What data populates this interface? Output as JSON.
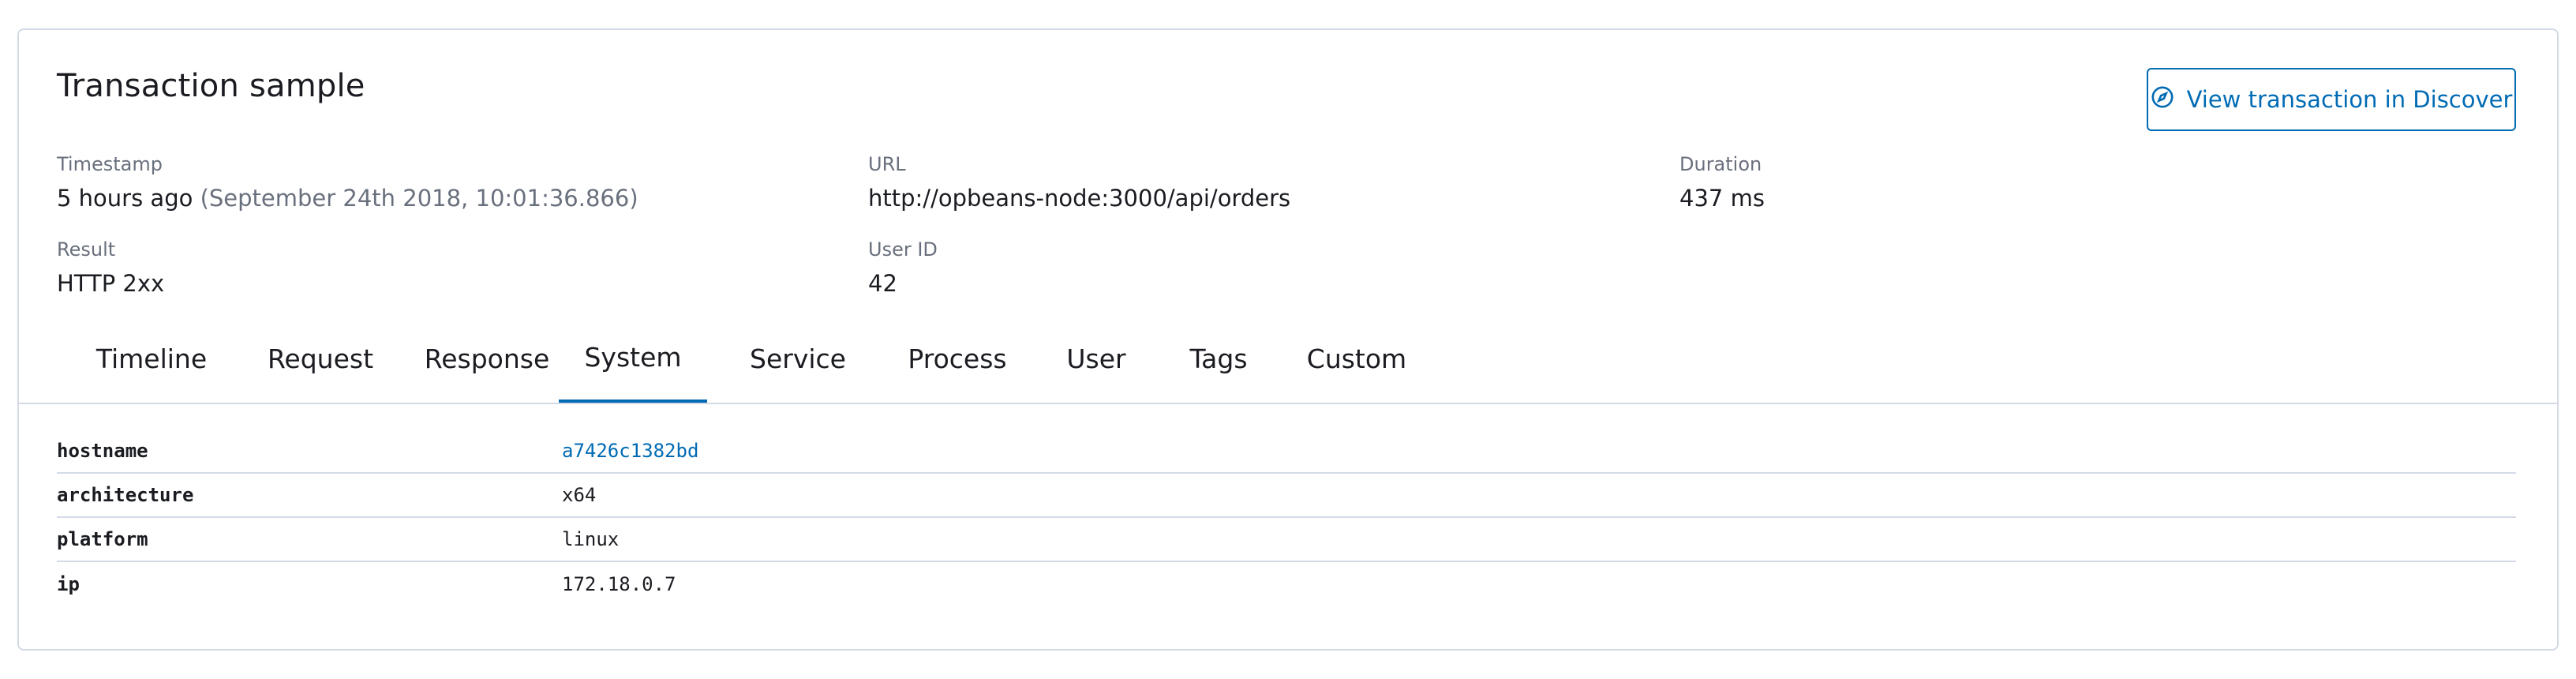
{
  "panel": {
    "title": "Transaction sample",
    "discover_button": {
      "label": "View transaction in Discover",
      "icon": "compass-icon"
    }
  },
  "summary": {
    "timestamp": {
      "label": "Timestamp",
      "relative": "5 hours ago",
      "absolute": "(September 24th 2018, 10:01:36.866)"
    },
    "url": {
      "label": "URL",
      "value": "http://opbeans-node:3000/api/orders"
    },
    "duration": {
      "label": "Duration",
      "value": "437 ms"
    },
    "result": {
      "label": "Result",
      "value": "HTTP 2xx"
    },
    "user_id": {
      "label": "User ID",
      "value": "42"
    }
  },
  "tabs": [
    {
      "label": "Timeline"
    },
    {
      "label": "Request"
    },
    {
      "label": "Response"
    },
    {
      "label": "System",
      "active": true
    },
    {
      "label": "Service"
    },
    {
      "label": "Process"
    },
    {
      "label": "User"
    },
    {
      "label": "Tags"
    },
    {
      "label": "Custom"
    }
  ],
  "system_table": [
    {
      "key": "hostname",
      "value": "a7426c1382bd",
      "link": true
    },
    {
      "key": "architecture",
      "value": "x64"
    },
    {
      "key": "platform",
      "value": "linux"
    },
    {
      "key": "ip",
      "value": "172.18.0.7"
    }
  ],
  "colors": {
    "accent": "#006bb4",
    "border": "#d3dae6",
    "muted_text": "#69707d"
  }
}
